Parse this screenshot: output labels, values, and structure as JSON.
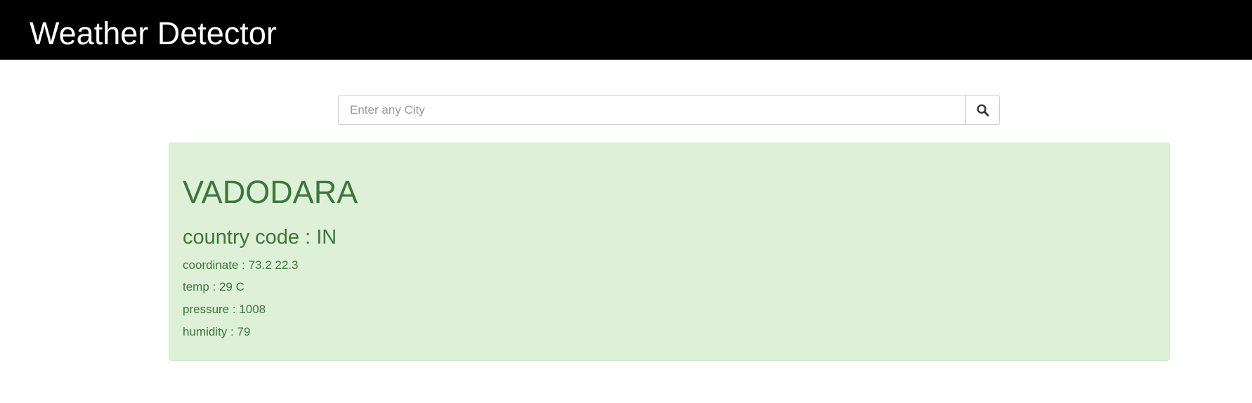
{
  "header": {
    "title": "Weather Detector",
    "background": "#000000"
  },
  "search": {
    "placeholder": "Enter any City",
    "value": "",
    "button_icon": "search-icon"
  },
  "result": {
    "city": "VADODARA",
    "country_label": "country code : ",
    "country_code": "IN",
    "coordinate_label": "coordinate : ",
    "coordinate_value": "73.2 22.3",
    "temp_label": "temp : ",
    "temp_value": "29 C",
    "pressure_label": "pressure : ",
    "pressure_value": "1008",
    "humidity_label": "humidity : ",
    "humidity_value": "79",
    "panel_color": "#dff0d8",
    "text_color": "#3c763d"
  }
}
